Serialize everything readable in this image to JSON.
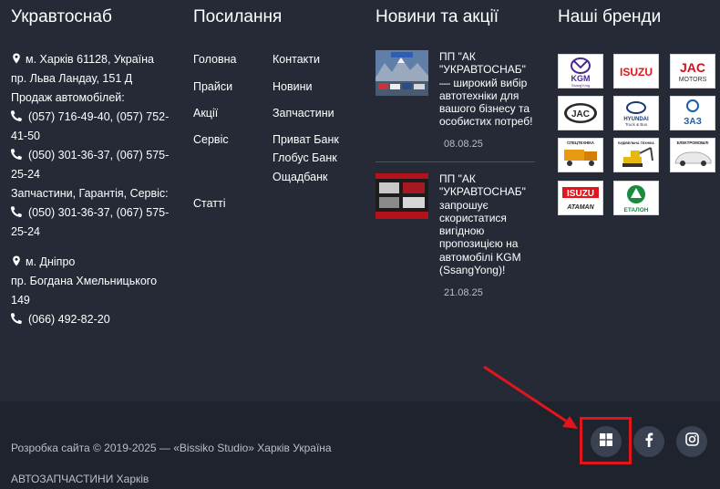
{
  "columns": {
    "company": {
      "title": "Укравтоснаб",
      "address1_line1": "м. Харків 61128, Україна",
      "address1_line2": "пр. Льва Ландау, 151 Д",
      "sales_label": "Продаж автомобілей:",
      "phone1_line1": "(057) 716-49-40, (057) 752-",
      "phone1_line2": "41-50",
      "phone2_line1": "(050) 301-36-37, (067) 575-",
      "phone2_line2": "25-24",
      "parts_label": "Запчастини, Гарантія, Сервіс:",
      "phone3_line1": "(050) 301-36-37, (067) 575-",
      "phone3_line2": "25-24",
      "address2_line1": "м. Дніпро",
      "address2_line2": "пр. Богдана Хмельницького",
      "address2_line3": "149",
      "phone4": "(066) 492-82-20"
    },
    "links": {
      "title": "Посилання",
      "left": [
        "Головна",
        "Прайси",
        "Акції",
        "Сервіс",
        "Статті"
      ],
      "right": [
        "Контакти",
        "Новини",
        "Запчастини",
        "Приват Банк",
        "Глобус Банк",
        "Ощадбанк"
      ]
    },
    "news": {
      "title": "Новини та акції",
      "items": [
        {
          "lines": [
            "ПП \"АК",
            "\"УКРАВТОСНАБ\"",
            "— широкий вибір",
            "автотехніки для",
            "вашого бізнесу та",
            "особистих потреб!"
          ],
          "date": "08.08.25"
        },
        {
          "lines": [
            "ПП \"АК",
            "\"УКРАВТОСНАБ\"",
            "запрошує",
            "скористатися",
            "вигідною",
            "пропозицією на",
            "автомобілі KGM",
            "(SsangYong)!"
          ],
          "date": "21.08.25"
        }
      ]
    },
    "brands": {
      "title": "Наші бренди",
      "items": [
        {
          "text": "KGM",
          "sub": "SsangYong"
        },
        {
          "text": "ISUZU",
          "sub": ""
        },
        {
          "text": "JAC",
          "sub": "MOTORS"
        },
        {
          "text": "JAC",
          "sub": ""
        },
        {
          "text": "HYUNDAI",
          "sub": "Truck & Bus"
        },
        {
          "text": "ЗАЗ",
          "sub": ""
        },
        {
          "text": "СПЕЦТЕХНІКА",
          "sub": ""
        },
        {
          "text": "БУДІВЕЛЬНА ТЕХНІКА",
          "sub": ""
        },
        {
          "text": "ЕЛЕКТРОМОБІЛІ",
          "sub": ""
        },
        {
          "text": "ISUZU",
          "sub": "ATAMAN"
        },
        {
          "text": "ЕТАЛОН",
          "sub": ""
        }
      ]
    }
  },
  "footer": {
    "copyright": "Розробка сайта © 2019-2025 — «Bissiko Studio» Харків Україна",
    "tagline": "АВТОЗАПЧАСТИНИ Харків"
  },
  "colors": {
    "background": "#252a36",
    "footer_background": "#1f232d",
    "social_bg": "#3a4150",
    "highlight": "#e0161b"
  },
  "icons": [
    "map-marker-icon",
    "phone-icon",
    "windows-icon",
    "facebook-icon",
    "instagram-icon"
  ]
}
